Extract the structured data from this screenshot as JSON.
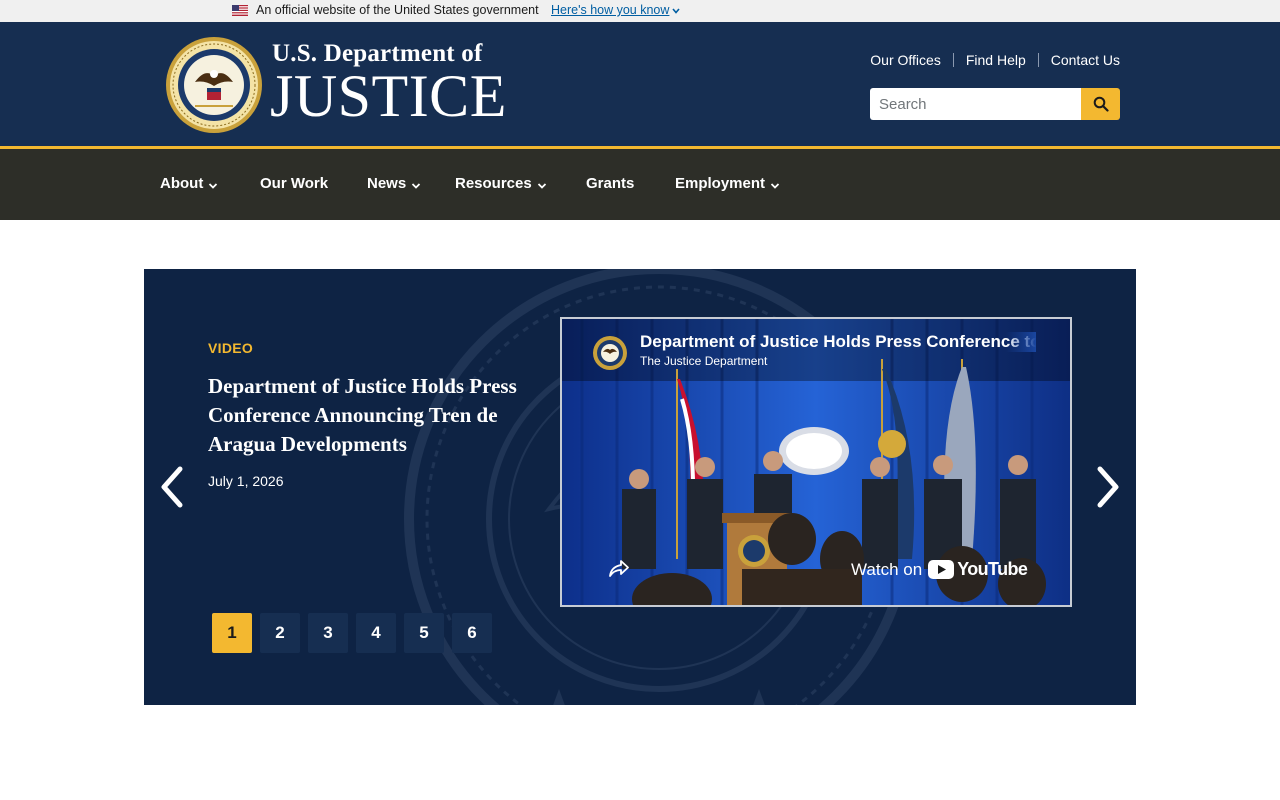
{
  "gov_banner": {
    "official_text": "An official website of the United States government",
    "how_link": "Here's how you know"
  },
  "header": {
    "brand_top": "U.S. Department of",
    "brand_main": "JUSTICE",
    "utility_links": [
      "Our Offices",
      "Find Help",
      "Contact Us"
    ],
    "search_placeholder": "Search"
  },
  "nav": {
    "items": [
      {
        "label": "About",
        "dropdown": true
      },
      {
        "label": "Our Work",
        "dropdown": false
      },
      {
        "label": "News",
        "dropdown": true
      },
      {
        "label": "Resources",
        "dropdown": true
      },
      {
        "label": "Grants",
        "dropdown": false
      },
      {
        "label": "Employment",
        "dropdown": true
      }
    ]
  },
  "carousel": {
    "kicker": "VIDEO",
    "title": "Department of Justice Holds Press Conference Announcing Tren de Aragua Developments",
    "date": "July 1, 2026",
    "video": {
      "title": "Department of Justice Holds Press Conference to",
      "channel": "The Justice Department",
      "watch_on": "Watch on",
      "platform": "YouTube"
    },
    "pages": [
      "1",
      "2",
      "3",
      "4",
      "5",
      "6"
    ],
    "active_page": "1"
  },
  "colors": {
    "header_bg": "#162e51",
    "accent_gold": "#f3b830",
    "nav_bg": "#2d2e28",
    "carousel_bg": "#0e2344"
  }
}
